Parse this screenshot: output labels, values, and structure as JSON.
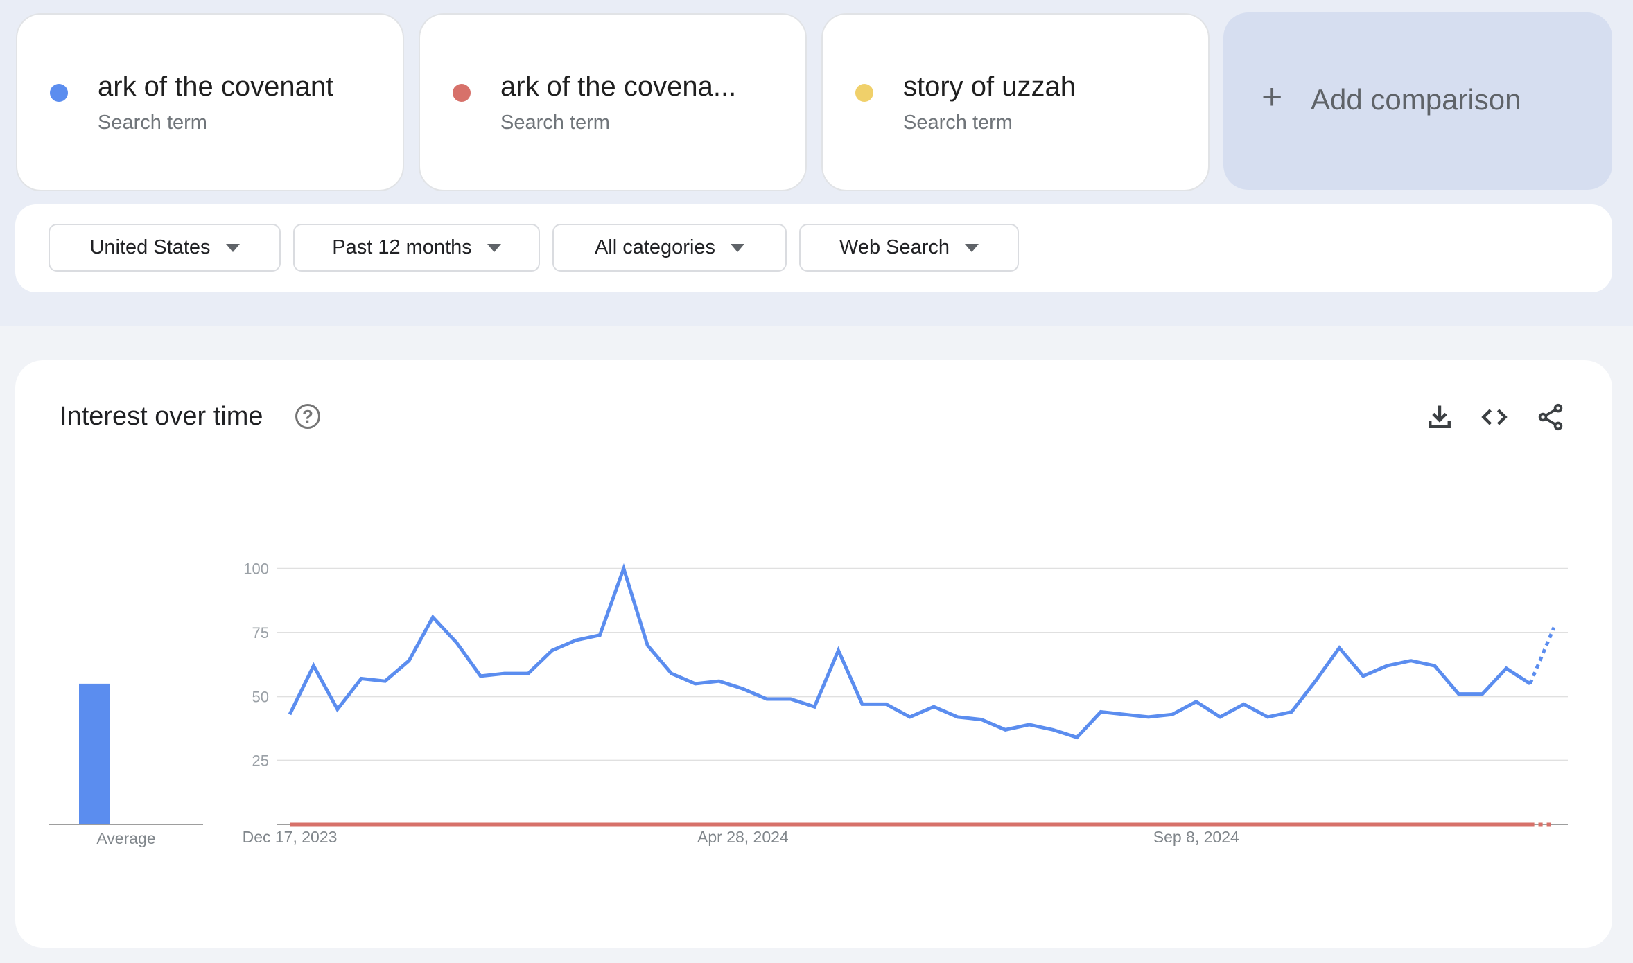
{
  "comparison": {
    "terms": [
      {
        "name": "ark of the covenant",
        "subtitle": "Search term",
        "color": "#5b8def"
      },
      {
        "name": "ark of the covena...",
        "subtitle": "Search term",
        "color": "#d7716a"
      },
      {
        "name": "story of uzzah",
        "subtitle": "Search term",
        "color": "#f0d06a"
      }
    ],
    "add_label": "Add comparison",
    "add_icon": "plus-icon"
  },
  "filters": [
    {
      "label": "United States"
    },
    {
      "label": "Past 12 months"
    },
    {
      "label": "All categories"
    },
    {
      "label": "Web Search"
    }
  ],
  "section": {
    "title": "Interest over time",
    "help_icon": "help-circle-icon",
    "actions": [
      "download-icon",
      "embed-code-icon",
      "share-icon"
    ]
  },
  "chart_data": {
    "type": "line",
    "title": "Interest over time",
    "xlabel": "",
    "ylabel": "",
    "ylim": [
      0,
      100
    ],
    "yticks": [
      25,
      50,
      75,
      100
    ],
    "grid": true,
    "x_tick_labels": [
      {
        "label": "Dec 17, 2023",
        "index": 0
      },
      {
        "label": "Apr 28, 2024",
        "index": 19
      },
      {
        "label": "Sep 8, 2024",
        "index": 38
      }
    ],
    "num_points": 54,
    "partial_last_point": true,
    "series": [
      {
        "name": "ark of the covenant",
        "color": "#5b8def",
        "values": [
          43,
          62,
          45,
          57,
          56,
          64,
          81,
          71,
          58,
          59,
          59,
          68,
          72,
          74,
          100,
          70,
          59,
          55,
          56,
          53,
          49,
          49,
          46,
          68,
          47,
          47,
          42,
          46,
          42,
          41,
          37,
          39,
          37,
          34,
          44,
          43,
          42,
          43,
          48,
          42,
          47,
          42,
          44,
          56,
          69,
          58,
          62,
          64,
          62,
          51,
          51,
          61,
          55,
          77
        ]
      },
      {
        "name": "ark of the covena...",
        "color": "#d7716a",
        "values": [
          0,
          0,
          0,
          0,
          0,
          0,
          0,
          0,
          0,
          0,
          0,
          0,
          0,
          0,
          0,
          0,
          0,
          0,
          0,
          0,
          0,
          0,
          0,
          0,
          0,
          0,
          0,
          0,
          0,
          0,
          0,
          0,
          0,
          0,
          0,
          0,
          0,
          0,
          0,
          0,
          0,
          0,
          0,
          0,
          0,
          0,
          0,
          0,
          0,
          0,
          0,
          0,
          0,
          0
        ]
      },
      {
        "name": "story of uzzah",
        "color": "#f0d06a",
        "values": [
          0,
          0,
          0,
          0,
          0,
          0,
          0,
          0,
          0,
          0,
          0,
          0,
          0,
          0,
          0,
          0,
          0,
          0,
          0,
          0,
          0,
          0,
          0,
          0,
          0,
          0,
          0,
          0,
          0,
          0,
          0,
          0,
          0,
          0,
          0,
          0,
          0,
          0,
          0,
          0,
          0,
          0,
          0,
          0,
          0,
          0,
          0,
          0,
          0,
          0,
          0,
          0,
          0,
          0
        ]
      }
    ],
    "averages": {
      "label": "Average",
      "values": [
        55,
        0,
        0
      ]
    }
  }
}
